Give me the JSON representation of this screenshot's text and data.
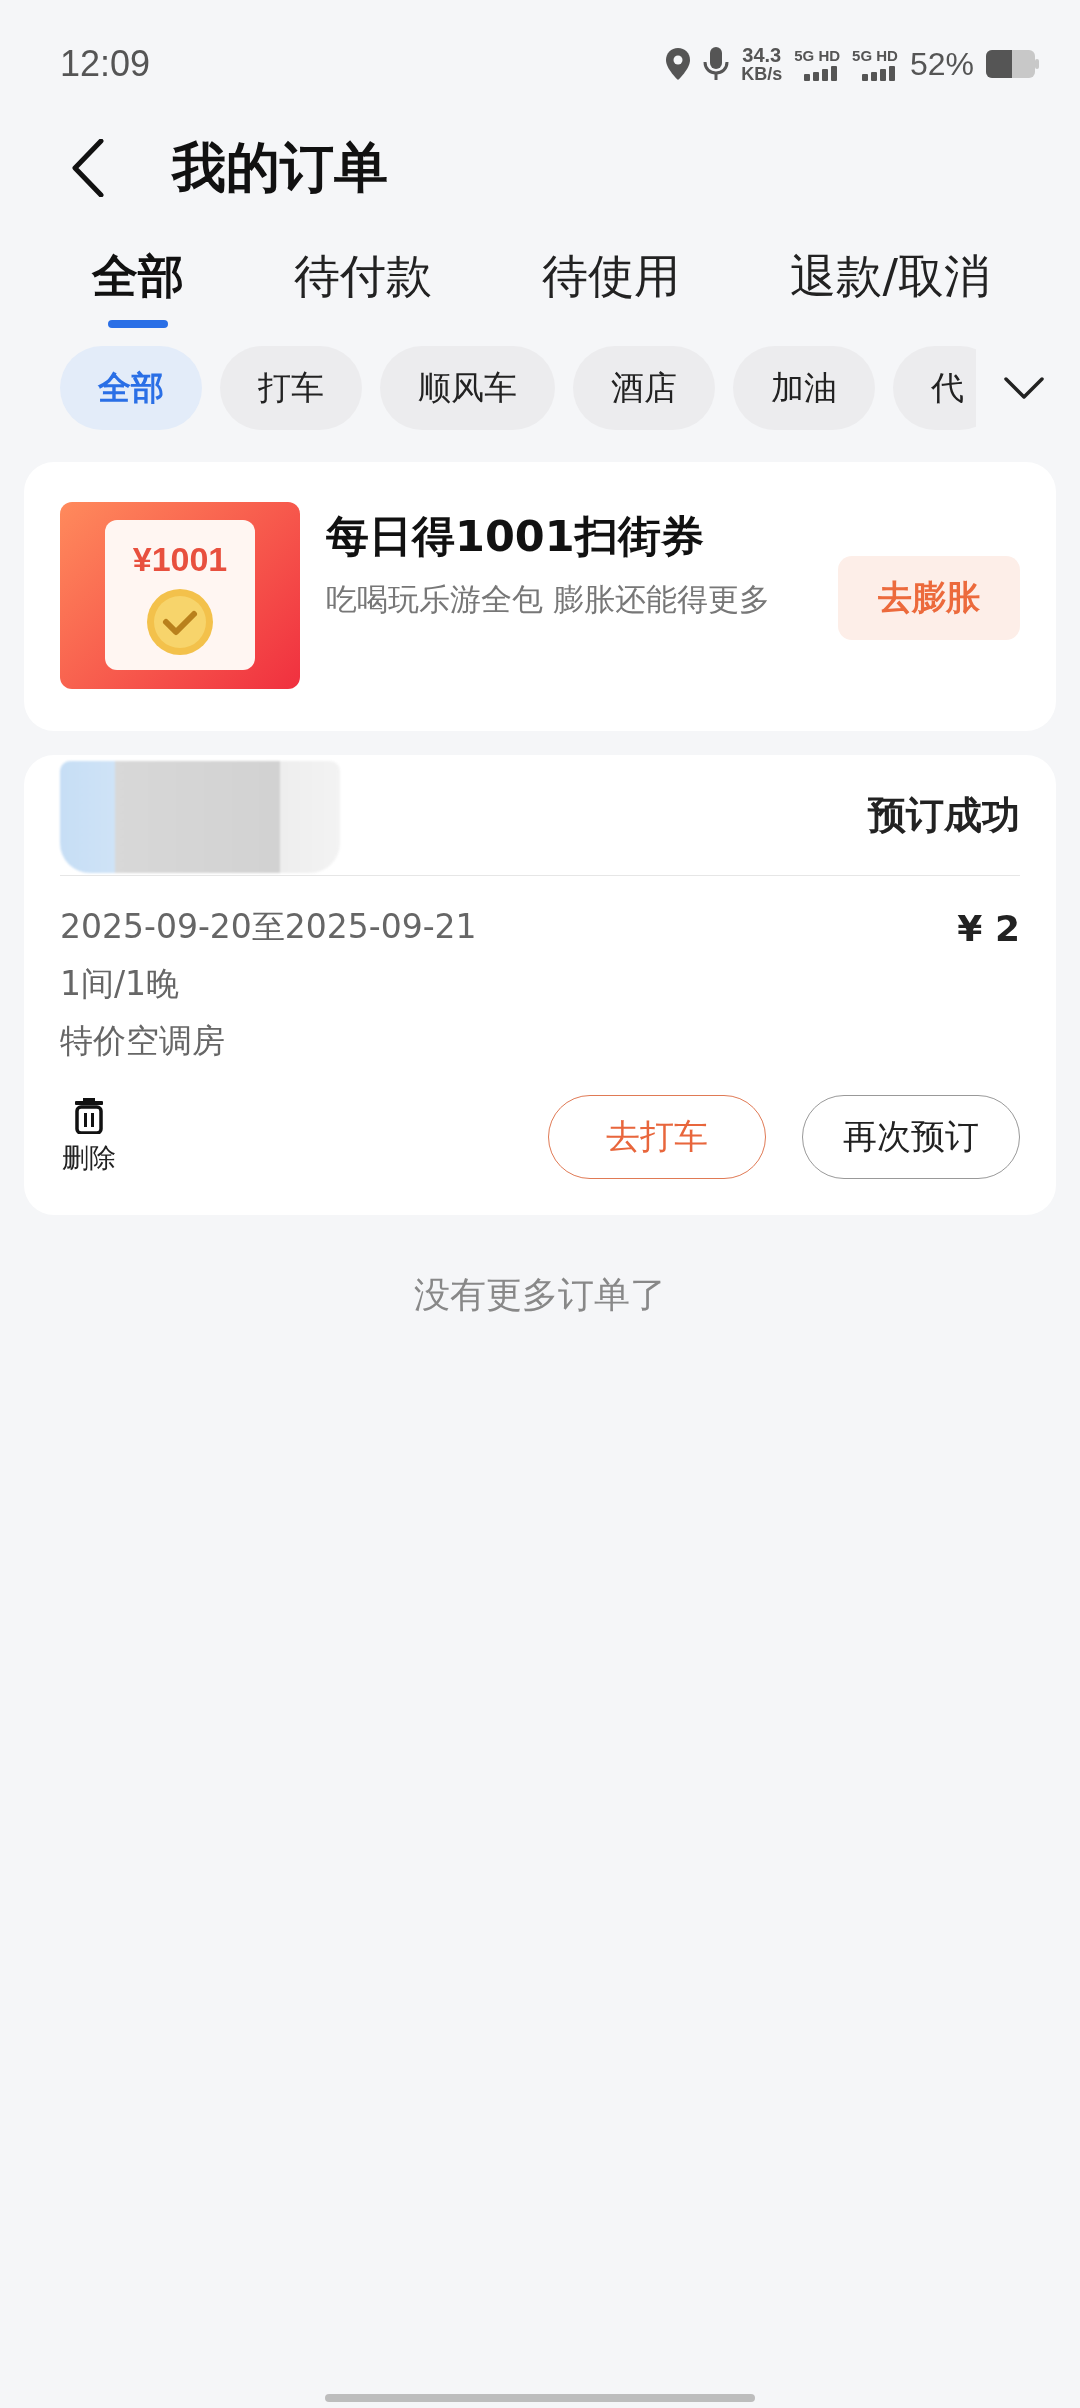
{
  "status_bar": {
    "time": "12:09",
    "net_speed": "34.3",
    "net_unit": "KB/s",
    "sim": [
      "5G HD",
      "5G HD"
    ],
    "battery": "52%"
  },
  "header": {
    "title": "我的订单"
  },
  "tabs": [
    {
      "label": "全部",
      "selected": true
    },
    {
      "label": "待付款",
      "selected": false
    },
    {
      "label": "待使用",
      "selected": false
    },
    {
      "label": "退款/取消",
      "selected": false
    }
  ],
  "filters": [
    {
      "label": "全部",
      "selected": true
    },
    {
      "label": "打车",
      "selected": false
    },
    {
      "label": "顺风车",
      "selected": false
    },
    {
      "label": "酒店",
      "selected": false
    },
    {
      "label": "加油",
      "selected": false
    },
    {
      "label": "代",
      "selected": false
    }
  ],
  "promo": {
    "image_amount": "¥1001",
    "title": "每日得1001扫街券",
    "subtitle": "吃喝玩乐游全包 膨胀还能得更多",
    "button": "去膨胀"
  },
  "orders": [
    {
      "status": "预订成功",
      "dates": "2025-09-20至2025-09-21",
      "rooms": "1间/1晚",
      "room_type": "特价空调房",
      "price": "¥ 2",
      "delete": "删除",
      "actions": [
        {
          "label": "去打车",
          "kind": "primary"
        },
        {
          "label": "再次预订",
          "kind": "secondary"
        }
      ]
    }
  ],
  "footer": "没有更多订单了"
}
